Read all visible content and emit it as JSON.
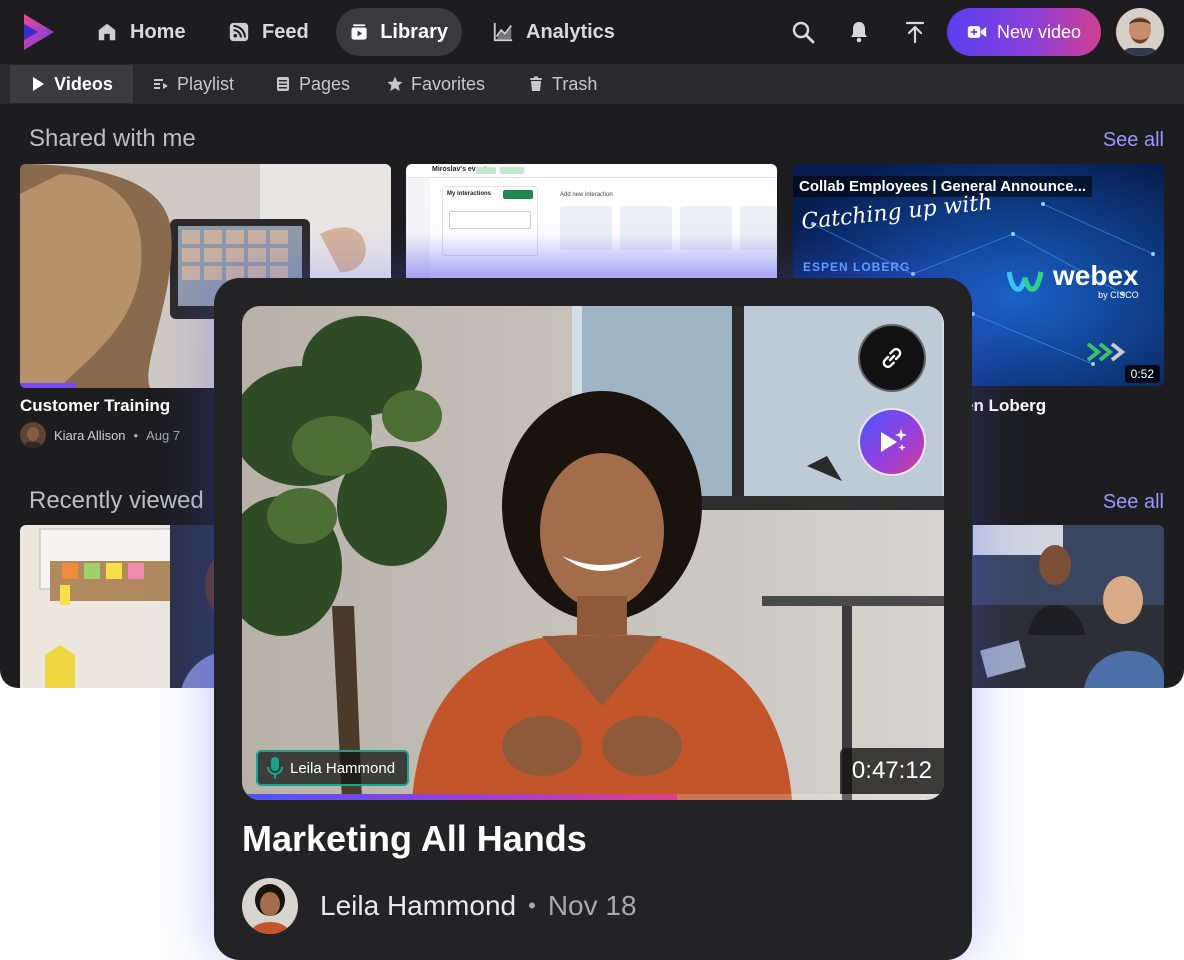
{
  "nav": {
    "items": [
      {
        "label": "Home",
        "icon": "home-icon"
      },
      {
        "label": "Feed",
        "icon": "rss-icon"
      },
      {
        "label": "Library",
        "icon": "library-icon"
      },
      {
        "label": "Analytics",
        "icon": "analytics-icon"
      }
    ],
    "active": "Library",
    "new_video_label": "New video"
  },
  "subnav": {
    "items": [
      {
        "label": "Videos",
        "icon": "play-icon"
      },
      {
        "label": "Playlist",
        "icon": "playlist-icon"
      },
      {
        "label": "Pages",
        "icon": "pages-icon"
      },
      {
        "label": "Favorites",
        "icon": "star-icon"
      },
      {
        "label": "Trash",
        "icon": "trash-icon"
      }
    ],
    "active": "Videos"
  },
  "sections": {
    "shared": {
      "title": "Shared with me",
      "see_all": "See all",
      "cards": [
        {
          "title": "Customer Training",
          "author": "Kiara Allison",
          "date": "Aug 7"
        },
        {
          "screenshot_header": "Miroslav's event",
          "my_interactions": "My interactions",
          "add_new": "Add new interaction"
        },
        {
          "overlay_title": "Collab Employees | General Announce...",
          "script_text": "Catching up with",
          "presenter": "ESPEN LOBERG",
          "brand": "webex",
          "brand_sub": "by CISCO",
          "duration": "0:52",
          "title_fragment": "en Loberg"
        }
      ]
    },
    "recent": {
      "title": "Recently viewed",
      "see_all": "See all"
    }
  },
  "featured": {
    "title": "Marketing All Hands",
    "author": "Leila Hammond",
    "date": "Nov 18",
    "speaker_tag": "Leila Hammond",
    "duration": "0:47:12",
    "progress": 0.62
  },
  "colors": {
    "accent": "#9f95ff",
    "gradient_start": "#5b3ff0",
    "gradient_end": "#d23f92",
    "speaker_border": "#19a38c"
  }
}
